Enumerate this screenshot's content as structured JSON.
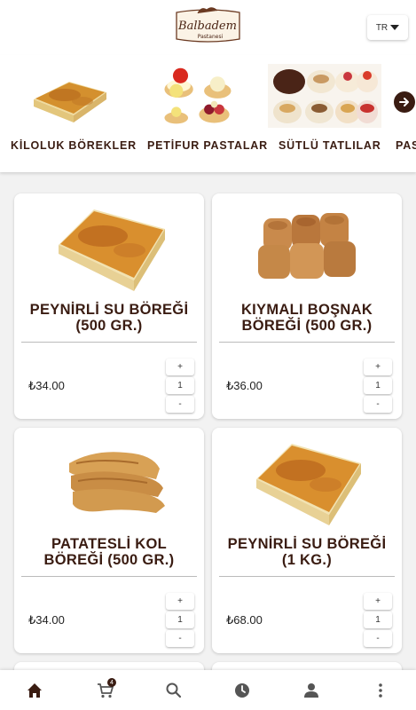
{
  "header": {
    "logo_text": "Balbadem",
    "logo_subtext": "Pastanesi",
    "language": "TR"
  },
  "categories": [
    {
      "label": "KİLOLUK BÖREKLER",
      "icon": "borek-image"
    },
    {
      "label": "PETİFUR PASTALAR",
      "icon": "petifur-image"
    },
    {
      "label": "SÜTLÜ TATLILAR",
      "icon": "sutlu-tatli-image"
    },
    {
      "label": "PAS",
      "icon": "pasta-image"
    }
  ],
  "products": [
    {
      "title": "PEYNİRLİ SU BÖREĞİ (500 GR.)",
      "price": "₺34.00",
      "qty": "1"
    },
    {
      "title": "KIYMALI BOŞNAK BÖREĞİ (500 GR.)",
      "price": "₺36.00",
      "qty": "1"
    },
    {
      "title": "PATATESLİ KOL BÖREĞİ (500 GR.)",
      "price": "₺34.00",
      "qty": "1"
    },
    {
      "title": "PEYNİRLİ SU BÖREĞİ (1 KG.)",
      "price": "₺68.00",
      "qty": "1"
    }
  ],
  "stepper": {
    "plus": "+",
    "minus": "-"
  },
  "nav": {
    "cart_count": "4",
    "items": [
      "home-icon",
      "cart-icon",
      "search-icon",
      "history-icon",
      "account-icon",
      "more-icon"
    ]
  },
  "colors": {
    "brand": "#3a1c12",
    "background": "#f2f2f2"
  }
}
